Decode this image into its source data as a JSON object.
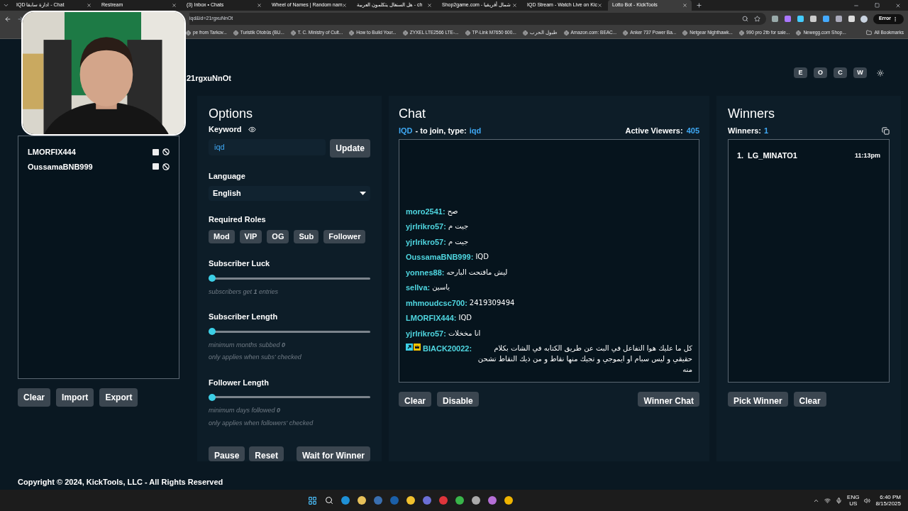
{
  "browser": {
    "tabs": [
      {
        "title": "IQD ادارة سابقا - Chat",
        "selected": false
      },
      {
        "title": "Restream",
        "selected": false
      },
      {
        "title": "(3) Inbox • Chats",
        "selected": false
      },
      {
        "title": "Wheel of Names | Random nam",
        "selected": false
      },
      {
        "title": "هل السنغال يتكلمون العربية - ch",
        "selected": false
      },
      {
        "title": "Shop2game.com - شمال أفريقيا",
        "selected": false
      },
      {
        "title": "IQD Stream - Watch Live on Kic",
        "selected": false
      },
      {
        "title": "Lotto Bot - KickTools",
        "selected": true
      }
    ],
    "address": "iqd&id=21rgxuNnOt",
    "profile_button": "Error",
    "bookmarks": [
      "pe from Tarkov...",
      "Turistik Otobüs (BU...",
      "T. C. Ministry of Cult...",
      "How to Build Your...",
      "ZYXEL LTE2566 LTE-...",
      "TP-Link M7650 600...",
      "طبول الحرب",
      "Amazon.com: BEAC...",
      "Anker 737 Power Ba...",
      "Netgear Nighthawk...",
      "990 pro 2tb for sale...",
      "Newegg.com Shop..."
    ],
    "all_bookmarks": "All Bookmarks"
  },
  "header": {
    "subtitle_end": "21rgxuNnOt",
    "theme_buttons": [
      "E",
      "O",
      "C",
      "W"
    ]
  },
  "entries": {
    "names": [
      "LMORFIX444",
      "OussamaBNB999"
    ],
    "buttons": [
      "Clear",
      "Import",
      "Export"
    ]
  },
  "options": {
    "title": "Options",
    "keyword_label": "Keyword",
    "keyword_value": "iqd",
    "update_button": "Update",
    "language_label": "Language",
    "language": "English",
    "roles_label": "Required Roles",
    "roles": [
      {
        "label": "Mod",
        "selected": false
      },
      {
        "label": "VIP",
        "selected": false
      },
      {
        "label": "OG",
        "selected": false
      },
      {
        "label": "Sub",
        "selected": false
      },
      {
        "label": "Follower",
        "selected": false
      }
    ],
    "sliders": [
      {
        "label": "Subscriber Luck",
        "level": 0,
        "notes": [
          "subscribers get **1** entries"
        ]
      },
      {
        "label": "Subscriber Length",
        "level": 0,
        "notes": [
          "minimum months subbed **0**",
          "only applies when subs' checked"
        ]
      },
      {
        "label": "Follower Length",
        "level": 0,
        "notes": [
          "minimum days followed **0**",
          "only applies when followers' checked"
        ]
      }
    ],
    "buttons": [
      "Pause",
      "Reset",
      "Wait for Winner"
    ]
  },
  "chat": {
    "title": "Chat",
    "keyword_name": "IQD",
    "join_text": "- to join, type:",
    "join_keyword": "iqd",
    "viewers_label": "Active Viewers:",
    "viewers": "405",
    "messages": [
      {
        "user": "moro2541:",
        "text": "صح",
        "badges": false
      },
      {
        "user": "yjrlrikro57:",
        "text": "جيت م",
        "badges": false
      },
      {
        "user": "yjrlrikro57:",
        "text": "جيت م",
        "badges": false
      },
      {
        "user": "OussamaBNB999:",
        "text": "IQD",
        "badges": false
      },
      {
        "user": "yonnes88:",
        "text": "ليش ماقتحت البارحه",
        "badges": false
      },
      {
        "user": "sellva:",
        "text": "ياسين",
        "badges": false
      },
      {
        "user": "mhmoudcsc700:",
        "text": "2419309494",
        "badges": false
      },
      {
        "user": "LMORFIX444:",
        "text": "IQD",
        "badges": false
      },
      {
        "user": "yjrlrikro57:",
        "text": "انا مخخلات",
        "badges": false
      },
      {
        "user": "BIACK20022:",
        "text": "كل ما عليك هوا التفاعل في البث عن طريق الكتابه في الشات بكلام حقيقي و ليس سبام او ايموجي و تجيك منها نقاط و من ذيك النقاط تشحن منه",
        "badges": true
      }
    ],
    "buttons": [
      "Clear",
      "Disable"
    ],
    "winner_chat_button": "Winner Chat"
  },
  "winners": {
    "title": "Winners",
    "count_label": "Winners:",
    "count": "1",
    "list": [
      {
        "rank": "1.",
        "name": "LG_MINATO1",
        "time": "11:13pm"
      }
    ],
    "buttons": [
      "Pick Winner",
      "Clear"
    ]
  },
  "footer": "Copyright © 2024, KickTools, LLC - All Rights Reserved",
  "taskbar": {
    "language": "ENG",
    "region": "US",
    "time": "6:40 PM",
    "date": "8/15/2025"
  }
}
